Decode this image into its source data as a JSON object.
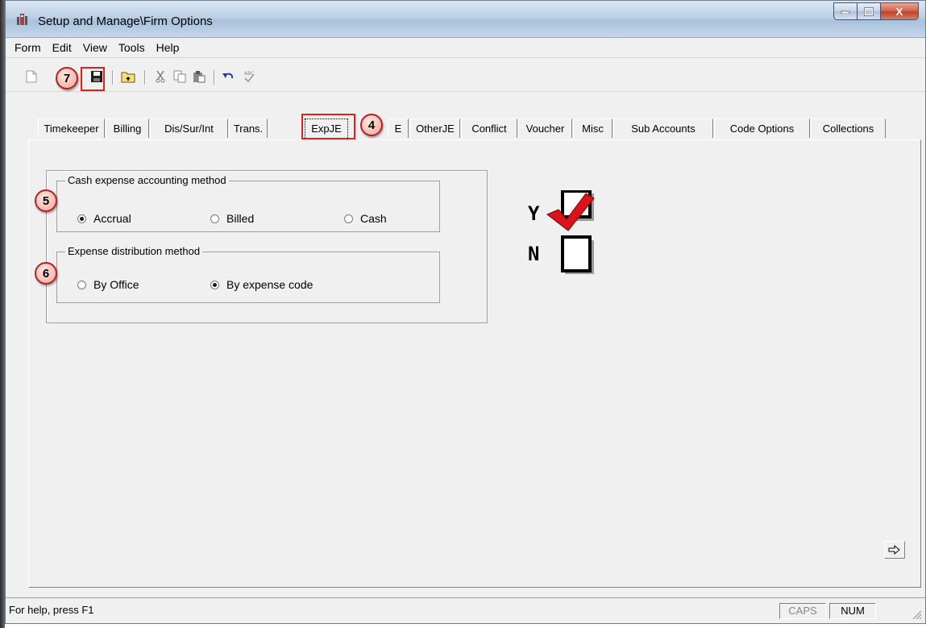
{
  "window": {
    "title": "Setup and Manage\\Firm Options",
    "controls": {
      "minimize": "—",
      "maximize": "□",
      "close": "X"
    }
  },
  "menu": [
    "Form",
    "Edit",
    "View",
    "Tools",
    "Help"
  ],
  "toolbar": {
    "icons": [
      "new-document-icon",
      "save-icon",
      "open-folder-icon",
      "cut-icon",
      "copy-icon",
      "paste-icon",
      "undo-icon",
      "spellcheck-icon"
    ]
  },
  "badges": {
    "b4": "4",
    "b5": "5",
    "b6": "6",
    "b7": "7"
  },
  "tabs": [
    {
      "label": "Timekeeper",
      "active": false
    },
    {
      "label": "Billing",
      "active": false
    },
    {
      "label": "Dis/Sur/Int",
      "active": false
    },
    {
      "label": "Trans.",
      "active": false
    },
    {
      "label": "ExpJE",
      "active": true
    },
    {
      "label": "E",
      "active": false
    },
    {
      "label": "OtherJE",
      "active": false
    },
    {
      "label": "Conflict",
      "active": false
    },
    {
      "label": "Voucher",
      "active": false
    },
    {
      "label": "Misc",
      "active": false
    },
    {
      "label": "Sub Accounts",
      "active": false
    },
    {
      "label": "Code Options",
      "active": false
    },
    {
      "label": "Collections",
      "active": false
    }
  ],
  "cash_group": {
    "label": "Cash expense accounting method",
    "options": [
      {
        "label": "Accrual",
        "selected": true
      },
      {
        "label": "Billed",
        "selected": false
      },
      {
        "label": "Cash",
        "selected": false
      }
    ]
  },
  "distribution_group": {
    "label": "Expense distribution method",
    "options": [
      {
        "label": "By Office",
        "selected": false
      },
      {
        "label": "By expense code",
        "selected": true
      }
    ]
  },
  "yn_graphic": {
    "yes": "Y",
    "no": "N"
  },
  "navigation": {
    "next_icon": "arrow-right-icon"
  },
  "status": {
    "help": "For help, press F1",
    "caps": "CAPS",
    "num": "NUM"
  },
  "colors": {
    "highlight": "#e01f1f",
    "badge_border": "#b22222",
    "check": "#d9141b"
  }
}
